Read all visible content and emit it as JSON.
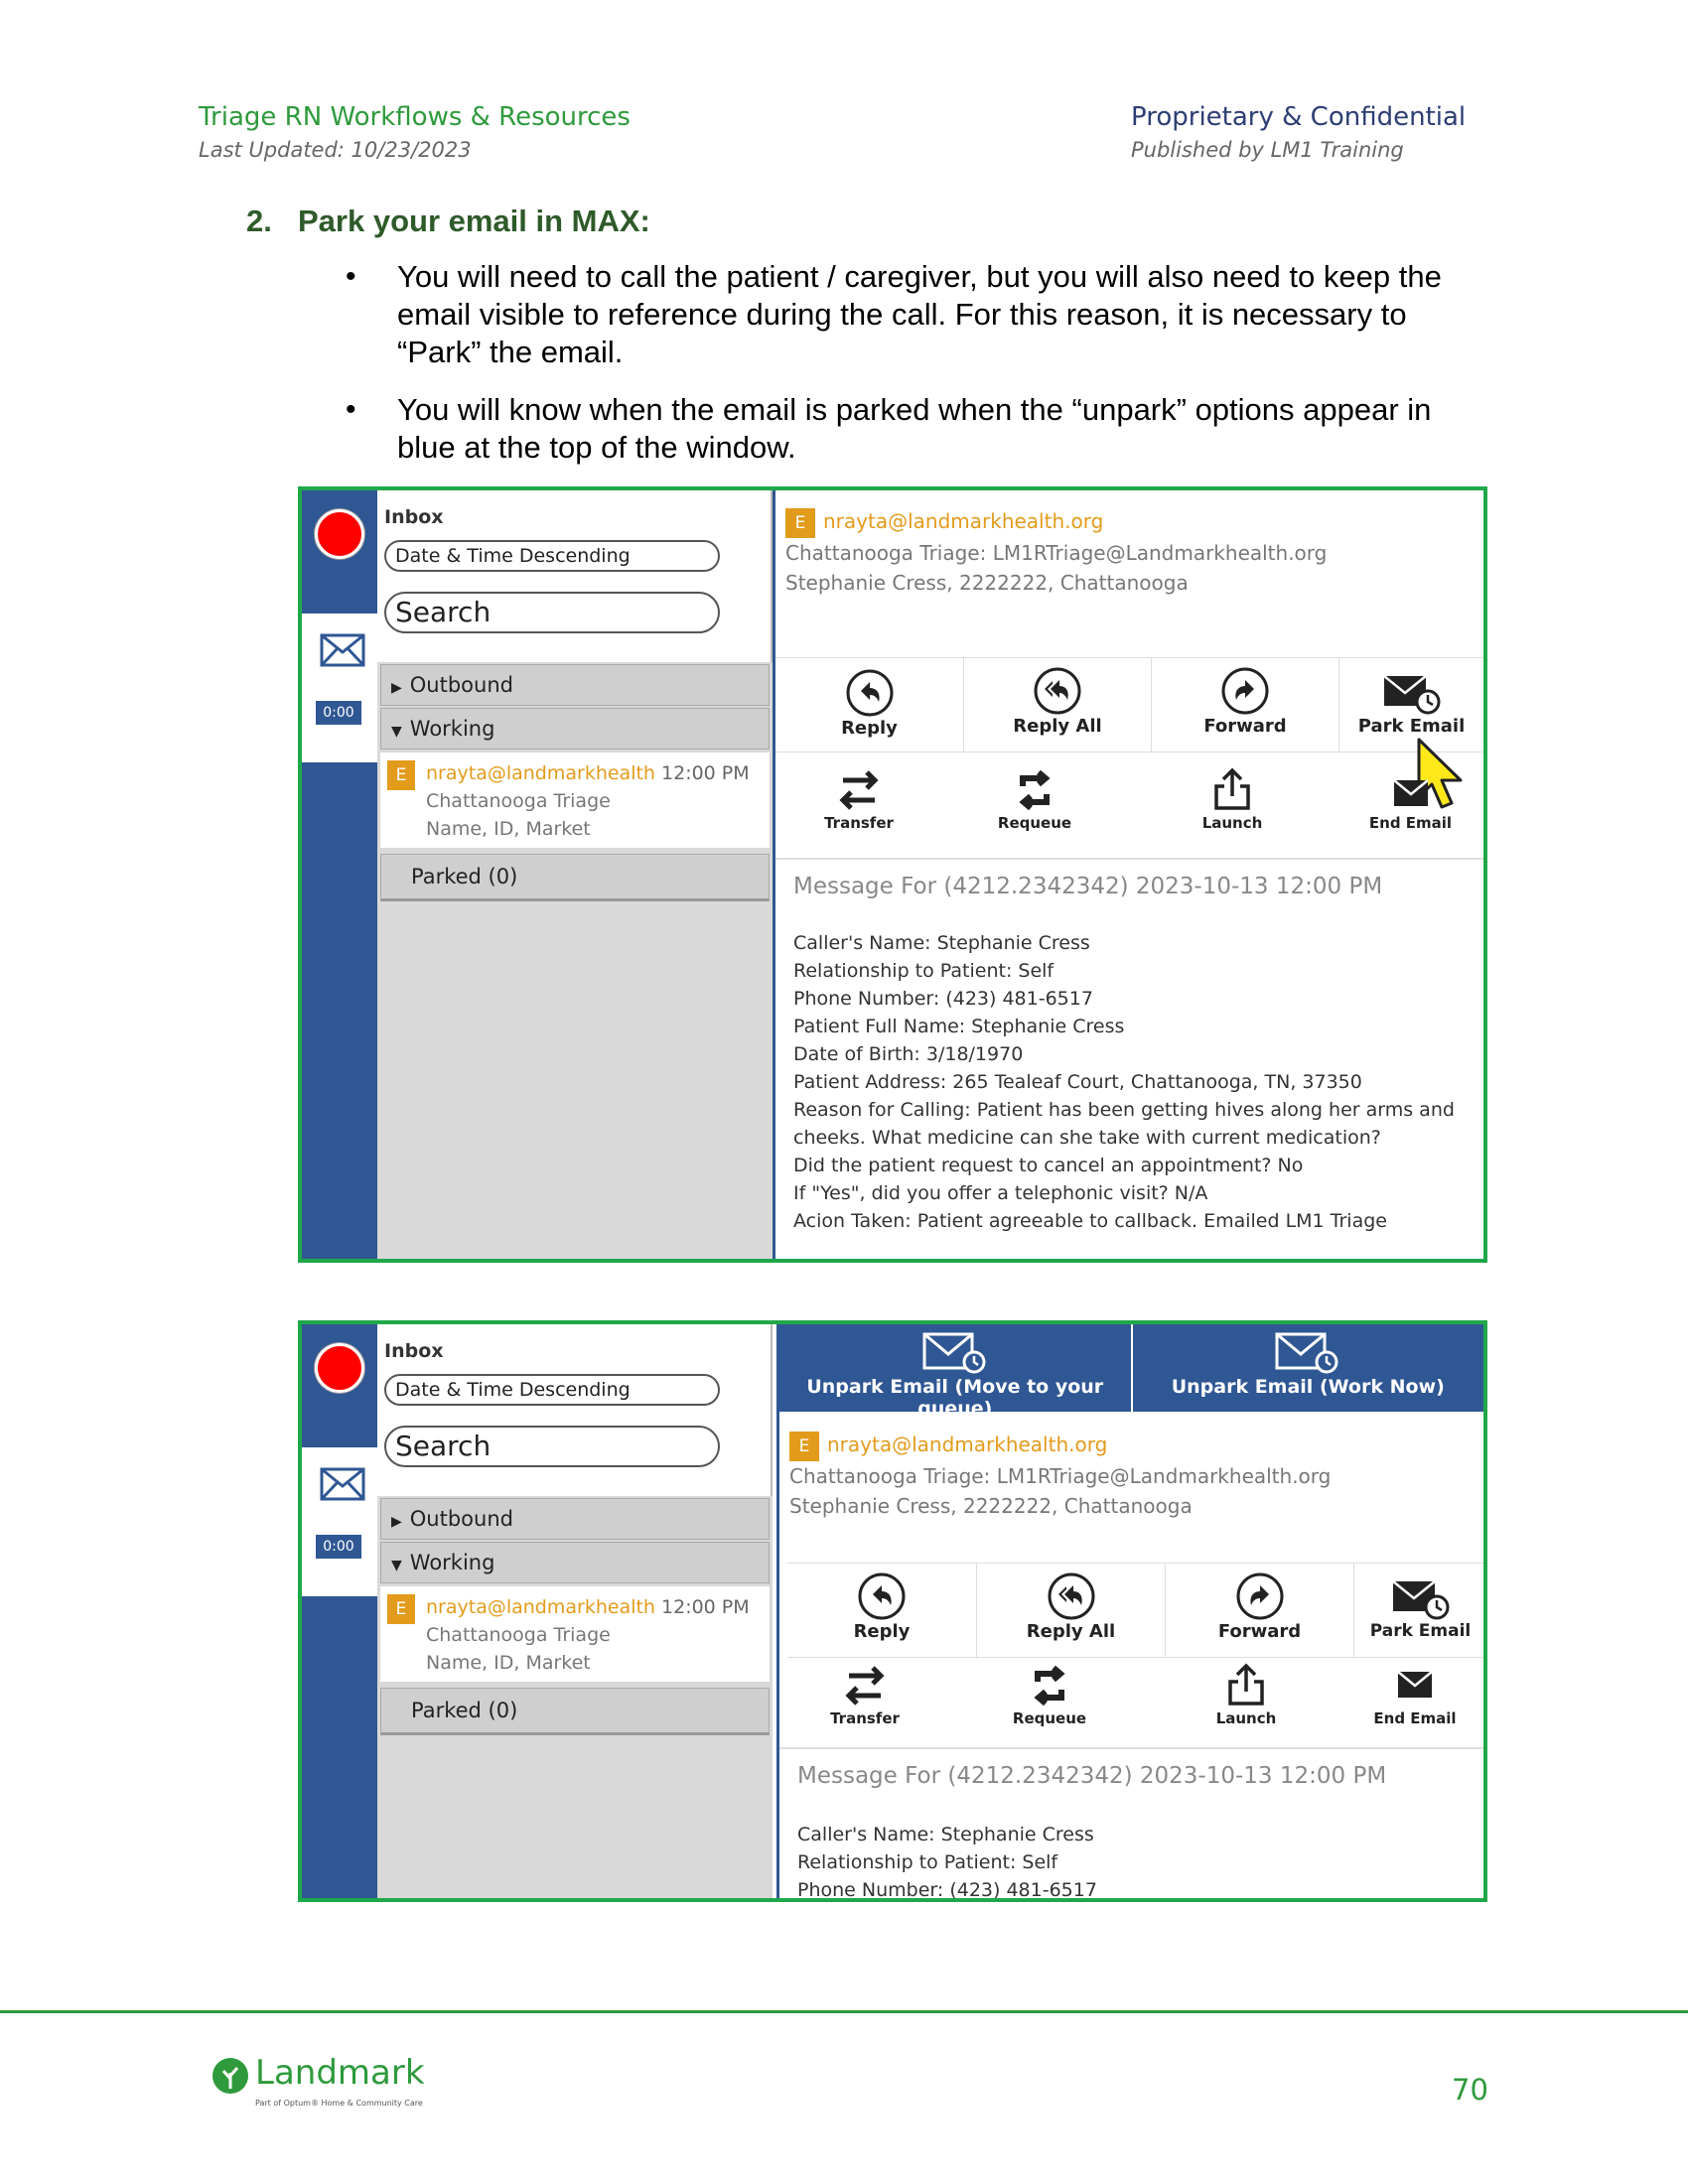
{
  "header": {
    "left_title": "Triage RN Workflows & Resources",
    "left_subtitle": "Last Updated: 10/23/2023",
    "right_title": "Proprietary & Confidential",
    "right_subtitle": "Published by LM1 Training"
  },
  "step": {
    "number": "2.",
    "title": "Park your email in MAX:",
    "bullets": [
      "You will need to call the patient / caregiver, but you will also need to keep the email visible to reference during the call. For this reason, it is necessary to “Park” the email.",
      "You will know when the email is parked when the “unpark” options appear in blue at the top of the window."
    ]
  },
  "max_ui": {
    "timer": "0:00",
    "inbox_label": "Inbox",
    "sort_value": "Date & Time Descending",
    "search_placeholder": "Search",
    "folders": {
      "outbound": "Outbound",
      "working": "Working",
      "parked": "Parked (0)"
    },
    "mail_item": {
      "badge": "E",
      "from": "nrayta@landmarkhealth",
      "time": "12:00 PM",
      "line2": "Chattanooga Triage",
      "line3": "Name, ID, Market"
    },
    "email_header": {
      "from": "nrayta@landmarkhealth.org",
      "to": "Chattanooga Triage: LM1RTriage@Landmarkhealth.org",
      "patient": "Stephanie Cress, 2222222, Chattanooga"
    },
    "actions": {
      "reply": "Reply",
      "reply_all": "Reply All",
      "forward": "Forward",
      "park_email": "Park Email"
    },
    "tools": {
      "transfer": "Transfer",
      "requeue": "Requeue",
      "launch": "Launch",
      "end_email": "End Email"
    },
    "unpark": {
      "queue": "Unpark Email (Move to your queue)",
      "now": "Unpark Email (Work Now)"
    },
    "message": {
      "title": "Message For (4212.2342342) 2023-10-13 12:00 PM",
      "lines": [
        "Caller's Name: Stephanie Cress",
        "Relationship to Patient: Self",
        "Phone Number: (423) 481-6517",
        "Patient Full Name: Stephanie Cress",
        "Date of Birth: 3/18/1970",
        "Patient Address: 265 Tealeaf Court, Chattanooga, TN, 37350",
        "Reason for Calling: Patient has been getting hives along her arms and",
        "cheeks. What medicine can she take with current medication?",
        "Did the patient request to cancel an appointment? No",
        "If \"Yes\", did you offer a telephonic visit? N/A",
        "Acion Taken: Patient agreeable to callback. Emailed LM1 Triage"
      ]
    }
  },
  "footer": {
    "logo_word": "Landmark",
    "logo_tagline": "Part of Optum® Home & Community Care",
    "page_number": "70"
  },
  "colors": {
    "brand_green": "#2e9a3c",
    "max_blue": "#2f5793",
    "email_orange": "#e39b1c",
    "record_red": "#ff0000",
    "frame_green": "#1fa84a"
  }
}
